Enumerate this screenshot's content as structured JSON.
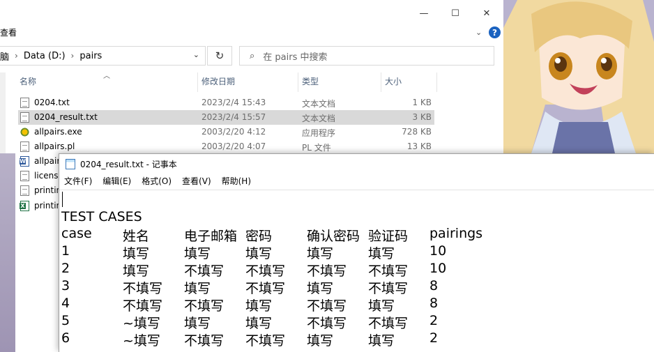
{
  "explorer": {
    "ribbon_label": "查看",
    "window_controls": {
      "minimize": "—",
      "maximize": "☐",
      "close": "✕"
    },
    "help": "?",
    "address": {
      "crumb_prev": "脑",
      "sep": "›",
      "drive": "Data (D:)",
      "folder": "pairs",
      "dropdown": "⌄"
    },
    "refresh": "↻",
    "search_placeholder": "在 pairs 中搜索",
    "columns": {
      "name": "名称",
      "date": "修改日期",
      "type": "类型",
      "size": "大小"
    },
    "files": [
      {
        "name": "0204.txt",
        "date": "2023/2/4 15:43",
        "type": "文本文档",
        "size": "1 KB",
        "icon": "text-doc"
      },
      {
        "name": "0204_result.txt",
        "date": "2023/2/4 15:57",
        "type": "文本文档",
        "size": "3 KB",
        "icon": "text-doc"
      },
      {
        "name": "allpairs.exe",
        "date": "2003/2/20 4:12",
        "type": "应用程序",
        "size": "728 KB",
        "icon": "exe"
      },
      {
        "name": "allpairs.pl",
        "date": "2003/2/20 4:07",
        "type": "PL 文件",
        "size": "13 KB",
        "icon": "text-doc"
      }
    ],
    "partial_files": [
      {
        "name": "allpair",
        "icon": "word"
      },
      {
        "name": "license",
        "icon": "text-doc"
      },
      {
        "name": "printin",
        "icon": "text-doc"
      },
      {
        "name": "printin",
        "icon": "excel"
      }
    ]
  },
  "notepad": {
    "title": "0204_result.txt - 记事本",
    "menus": [
      "文件(F)",
      "编辑(E)",
      "格式(O)",
      "查看(V)",
      "帮助(H)"
    ],
    "heading": "TEST CASES",
    "header_row": [
      "case",
      "姓名",
      "电子邮箱",
      "密码",
      "确认密码",
      "验证码",
      "pairings"
    ],
    "rows": [
      [
        "1",
        "填写",
        "填写",
        "填写",
        "填写",
        "填写",
        "10"
      ],
      [
        "2",
        "填写",
        "不填写",
        "不填写",
        "不填写",
        "不填写",
        "10"
      ],
      [
        "3",
        "不填写",
        "填写",
        "不填写",
        "填写",
        "不填写",
        "8"
      ],
      [
        "4",
        "不填写",
        "不填写",
        "填写",
        "不填写",
        "填写",
        "8"
      ],
      [
        "5",
        "~填写",
        "填写",
        "填写",
        "不填写",
        "不填写",
        "2"
      ],
      [
        "6",
        "~填写",
        "不填写",
        "不填写",
        "填写",
        "填写",
        "2"
      ]
    ]
  }
}
